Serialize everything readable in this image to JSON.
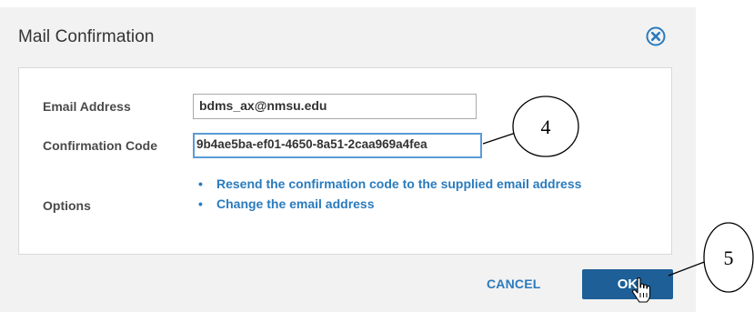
{
  "dialog": {
    "title": "Mail Confirmation",
    "close_icon": "close-circle-icon"
  },
  "form": {
    "email_label": "Email Address",
    "email_value": "bdms_ax@nmsu.edu",
    "code_label": "Confirmation Code",
    "code_value": "9b4ae5ba-ef01-4650-8a51-2caa969a4fea",
    "options_label": "Options",
    "options": [
      "Resend the confirmation code to the supplied email address",
      "Change the email address"
    ]
  },
  "buttons": {
    "cancel": "CANCEL",
    "ok": "OK"
  },
  "annotations": {
    "callout_code": "4",
    "callout_ok": "5"
  },
  "colors": {
    "accent": "#2a7bbd",
    "primary_button": "#1d5f96",
    "dialog_bg": "#f2f2f2"
  },
  "cursor_icon": "hand-pointer-icon"
}
